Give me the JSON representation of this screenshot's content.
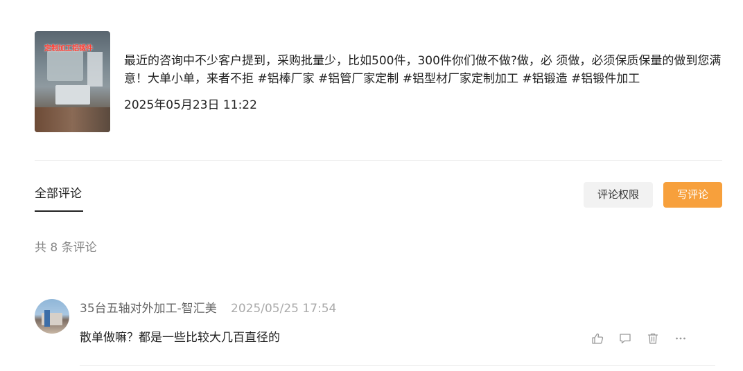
{
  "post": {
    "thumbnail_caption": "定制加工铝锻件",
    "text": "最近的咨询中不少客户提到，采购批量少，比如500件，300件你们做不做?做，必 须做，必须保质保量的做到您满意！大单小单，来者不拒 #铝棒厂家 #铝管厂家定制 #铝型材厂家定制加工 #铝锻造 #铝锻件加工",
    "date": "2025年05月23日 11:22"
  },
  "tabs": {
    "all_comments": "全部评论"
  },
  "actions": {
    "permission_button": "评论权限",
    "write_button": "写评论"
  },
  "comments_count_text": "共 8 条评论",
  "comments": [
    {
      "author": "35台五轴对外加工-智汇美",
      "time": "2025/05/25 17:54",
      "text": "散单做嘛？都是一些比较大几百直径的"
    }
  ],
  "icons": {
    "like": "thumbs-up-icon",
    "reply": "comment-icon",
    "delete": "trash-icon",
    "more": "more-icon"
  },
  "colors": {
    "accent": "#f7a03c",
    "muted_text": "#888888",
    "time_text": "#aaaaaa"
  }
}
